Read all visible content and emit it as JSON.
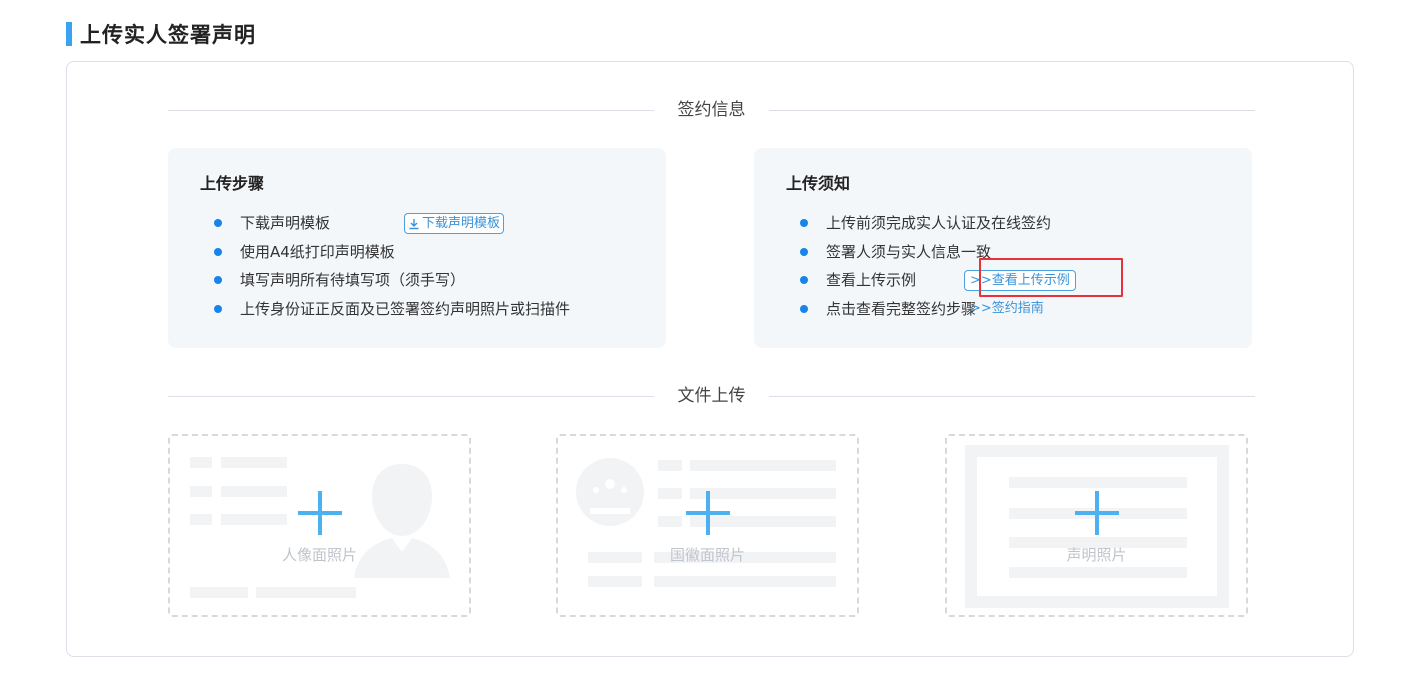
{
  "page": {
    "title": "上传实人签署声明"
  },
  "sections": {
    "sign_info": "签约信息",
    "file_upload": "文件上传"
  },
  "steps_card": {
    "title": "上传步骤",
    "items": [
      "下载声明模板",
      "使用A4纸打印声明模板",
      "填写声明所有待填写项（须手写）",
      "上传身份证正反面及已签署签约声明照片或扫描件"
    ],
    "download_button": "下载声明模板"
  },
  "notice_card": {
    "title": "上传须知",
    "items": [
      "上传前须完成实人认证及在线签约",
      "签署人须与实人信息一致",
      "查看上传示例",
      "点击查看完整签约步骤"
    ],
    "example_button": ">>查看上传示例",
    "guide_link": ">>签约指南"
  },
  "uploads": [
    {
      "caption": "人像面照片"
    },
    {
      "caption": "国徽面照片"
    },
    {
      "caption": "声明照片"
    }
  ],
  "colors": {
    "accent": "#3aa3f0",
    "link": "#3a93d8",
    "bullet": "#1684e8",
    "highlight": "#e8323a",
    "plus": "#4db1ef"
  }
}
